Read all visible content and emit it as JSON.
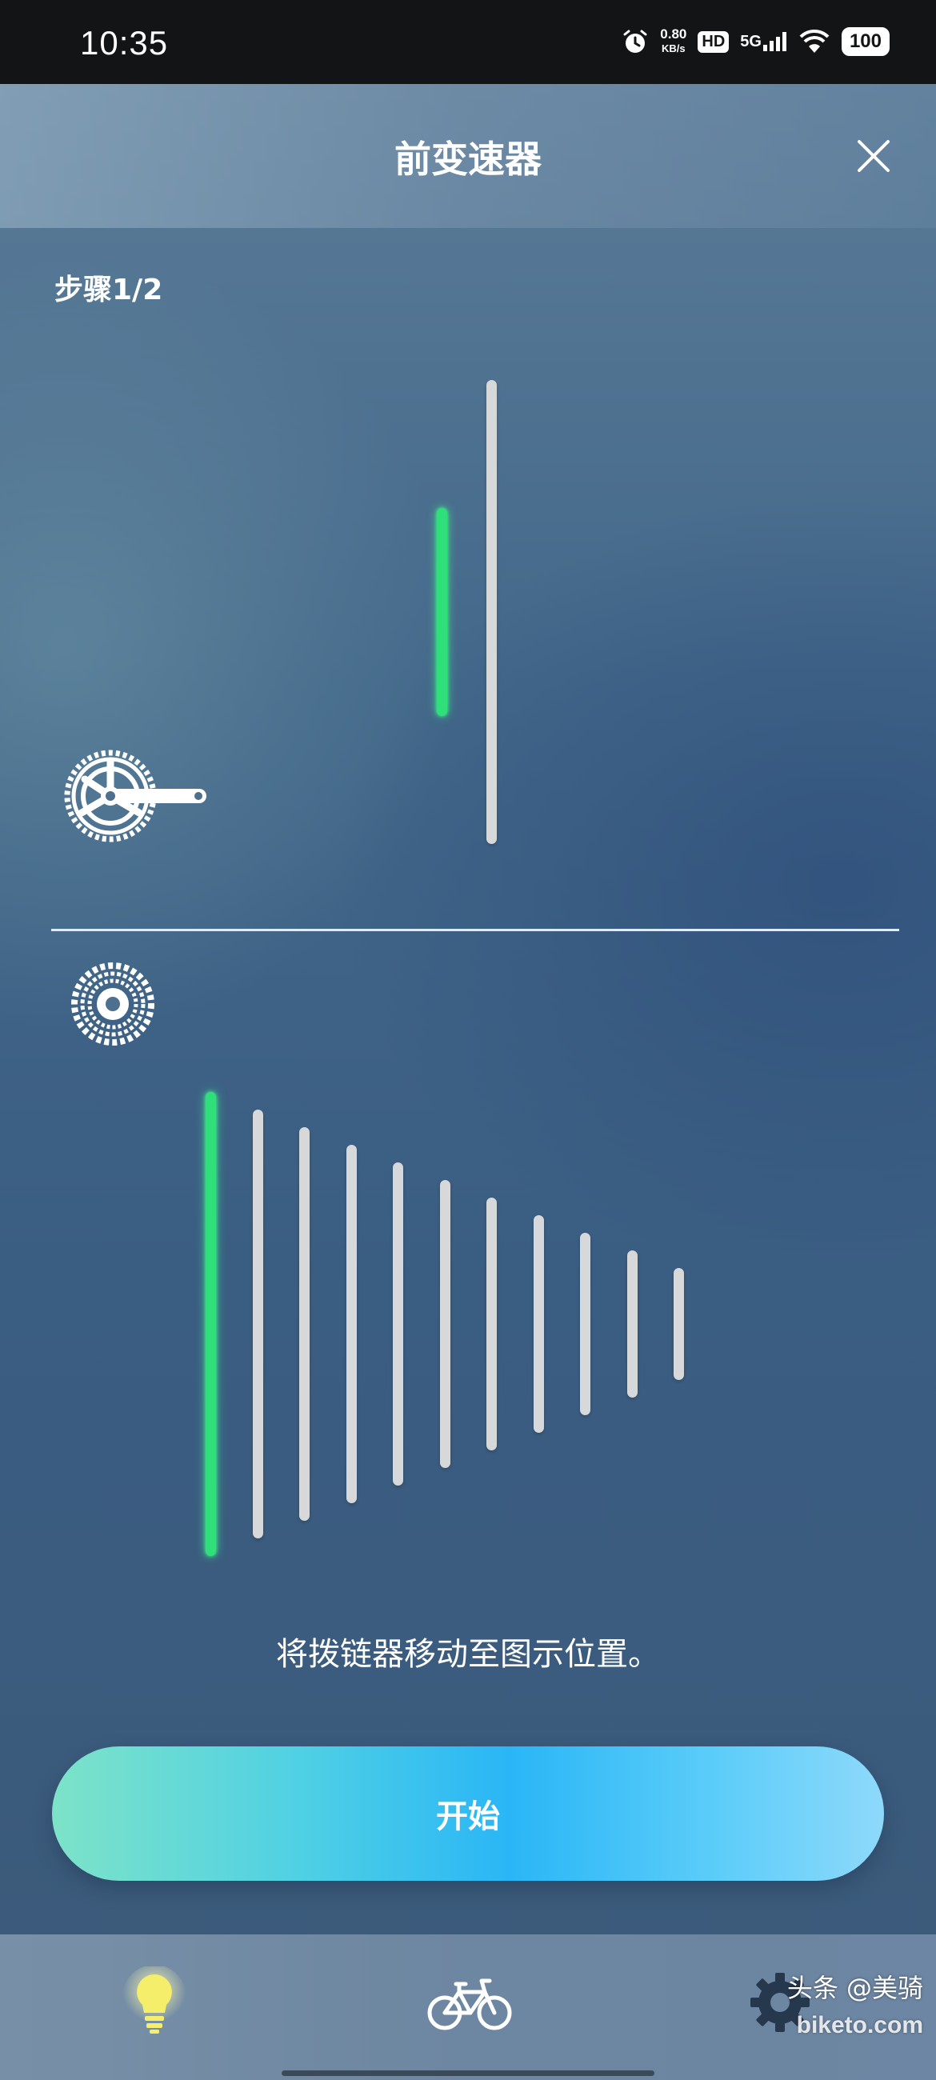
{
  "status_bar": {
    "time": "10:35",
    "speed_value": "0.80",
    "speed_unit": "KB/s",
    "hd_badge": "HD",
    "network": "5G",
    "battery": "100",
    "icons": [
      "alarm-icon",
      "signal-icon",
      "wifi-icon",
      "battery-icon"
    ]
  },
  "header": {
    "title": "前变速器",
    "close_icon": "close-icon"
  },
  "step": {
    "label": "步骤1/2"
  },
  "chainrings": {
    "count": 2,
    "active_index": 0,
    "icon": "crankset-icon"
  },
  "cassette": {
    "count": 11,
    "active_index": 0,
    "icon": "cassette-icon"
  },
  "instruction": "将拨链器移动至图示位置。",
  "start_button": {
    "label": "开始"
  },
  "bottom_nav": {
    "items": [
      {
        "name": "tips",
        "icon": "lightbulb-icon",
        "active": true
      },
      {
        "name": "bike",
        "icon": "bicycle-icon",
        "active": false
      },
      {
        "name": "settings",
        "icon": "gear-icon",
        "active": false
      }
    ]
  },
  "watermark": {
    "line1": "头条 @美骑",
    "line2": "biketo.com"
  },
  "colors": {
    "active_gear": "#2fe07a",
    "inactive_gear": "#d7d8da",
    "accent_button": "#2ab6f6",
    "active_nav": "#f4ee6a"
  }
}
